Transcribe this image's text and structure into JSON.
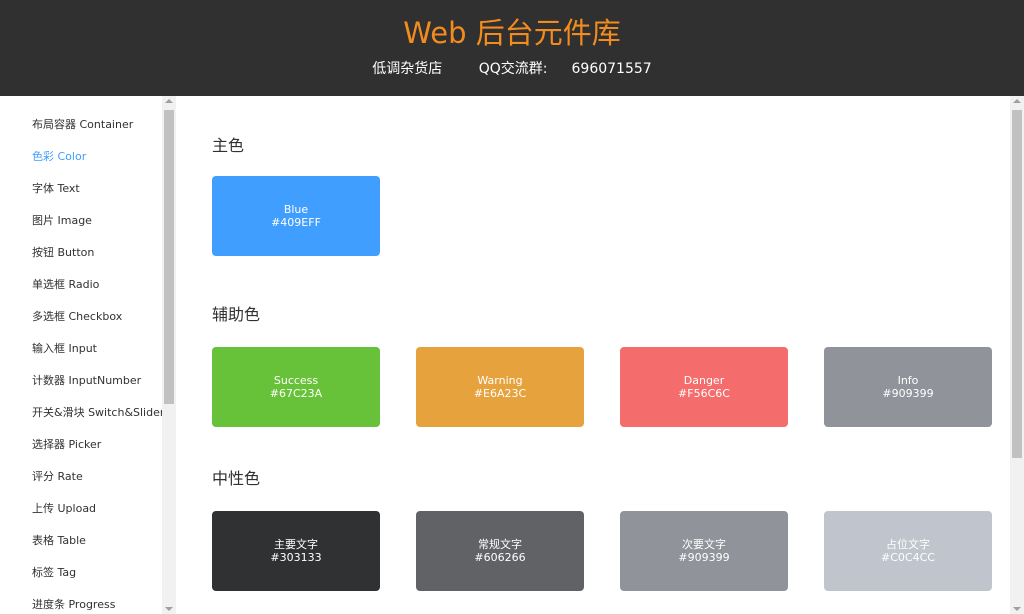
{
  "header": {
    "title": "Web 后台元件库",
    "shop": "低调杂货店",
    "qq_label": "QQ交流群:",
    "qq_number": "696071557",
    "title_color": "#F28C1E"
  },
  "sidebar": {
    "items": [
      {
        "label": "布局容器 Container",
        "active": false
      },
      {
        "label": "色彩 Color",
        "active": true
      },
      {
        "label": "字体 Text",
        "active": false
      },
      {
        "label": "图片 Image",
        "active": false
      },
      {
        "label": "按钮 Button",
        "active": false
      },
      {
        "label": "单选框 Radio",
        "active": false
      },
      {
        "label": "多选框 Checkbox",
        "active": false
      },
      {
        "label": "输入框 Input",
        "active": false
      },
      {
        "label": "计数器 InputNumber",
        "active": false
      },
      {
        "label": "开关&滑块 Switch&Slider",
        "active": false
      },
      {
        "label": "选择器 Picker",
        "active": false
      },
      {
        "label": "评分 Rate",
        "active": false
      },
      {
        "label": "上传 Upload",
        "active": false
      },
      {
        "label": "表格 Table",
        "active": false
      },
      {
        "label": "标签 Tag",
        "active": false
      },
      {
        "label": "进度条 Progress",
        "active": false
      }
    ]
  },
  "sections": {
    "primary": {
      "title": "主色",
      "swatches": [
        {
          "name": "Blue",
          "hex": "#409EFF"
        }
      ]
    },
    "secondary": {
      "title": "辅助色",
      "swatches": [
        {
          "name": "Success",
          "hex": "#67C23A"
        },
        {
          "name": "Warning",
          "hex": "#E6A23C"
        },
        {
          "name": "Danger",
          "hex": "#F56C6C"
        },
        {
          "name": "Info",
          "hex": "#909399"
        }
      ]
    },
    "neutral": {
      "title": "中性色",
      "swatches": [
        {
          "name": "主要文字",
          "hex": "#303133"
        },
        {
          "name": "常规文字",
          "hex": "#606266"
        },
        {
          "name": "次要文字",
          "hex": "#909399"
        },
        {
          "name": "占位文字",
          "hex": "#C0C4CC"
        }
      ]
    }
  }
}
